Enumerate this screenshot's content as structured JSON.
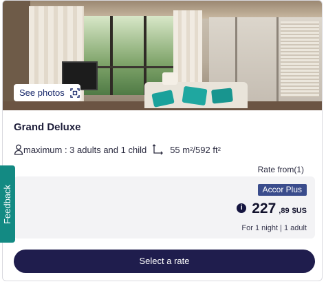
{
  "photo": {
    "see_photos_label": "See photos",
    "icon": "gallery-icon"
  },
  "room": {
    "title": "Grand Deluxe",
    "occupancy_icon": "person-icon",
    "occupancy_text": "maximum : 3 adults and 1 child",
    "size_icon": "area-icon",
    "size_text": "55 m²/592 ft²"
  },
  "rate": {
    "rate_from_label": "Rate from(1)",
    "badge_label": "Accor Plus",
    "info_icon": "info-icon",
    "price_integer": "227",
    "price_decimal": ",89",
    "currency": "$US",
    "stay_info": "For 1 night | 1 adult"
  },
  "actions": {
    "select_label": "Select a rate"
  },
  "feedback": {
    "label": "Feedback"
  },
  "colors": {
    "accent_navy": "#1f1d4d",
    "badge_blue": "#3a4c8c",
    "feedback_teal": "#138a83"
  }
}
